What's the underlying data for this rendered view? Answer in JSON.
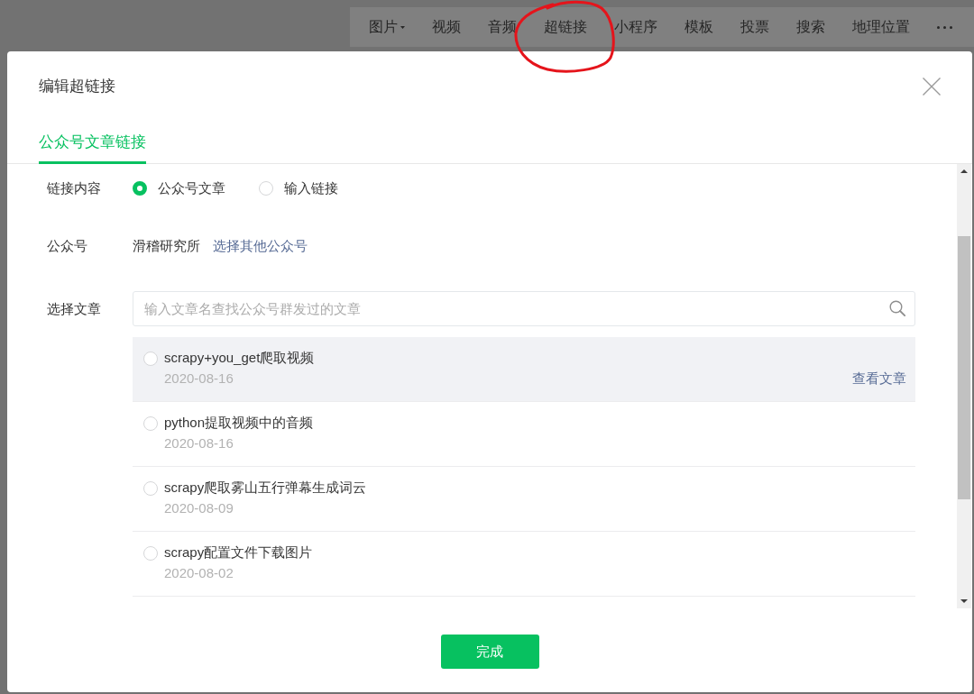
{
  "toolbar": {
    "items": [
      {
        "label": "图片",
        "dropdown": true,
        "circled": false
      },
      {
        "label": "视频",
        "dropdown": false,
        "circled": false
      },
      {
        "label": "音频",
        "dropdown": false,
        "circled": false
      },
      {
        "label": "超链接",
        "dropdown": false,
        "circled": true
      },
      {
        "label": "小程序",
        "dropdown": false,
        "circled": false
      },
      {
        "label": "模板",
        "dropdown": false,
        "circled": false
      },
      {
        "label": "投票",
        "dropdown": false,
        "circled": false
      },
      {
        "label": "搜索",
        "dropdown": false,
        "circled": false
      },
      {
        "label": "地理位置",
        "dropdown": false,
        "circled": false
      }
    ]
  },
  "dialog": {
    "title": "编辑超链接",
    "tabs": [
      {
        "label": "公众号文章链接",
        "selected": true
      }
    ],
    "link_content": {
      "label": "链接内容",
      "options": [
        {
          "label": "公众号文章",
          "selected": true
        },
        {
          "label": "输入链接",
          "selected": false
        }
      ]
    },
    "account": {
      "label": "公众号",
      "name": "滑稽研究所",
      "link": "选择其他公众号"
    },
    "article": {
      "label": "选择文章",
      "search": {
        "placeholder": "输入文章名查找公众号群发过的文章"
      },
      "items": [
        {
          "title": "scrapy+you_get爬取视频",
          "date": "2020-08-16",
          "selected": false,
          "hovered": true,
          "action": "查看文章"
        },
        {
          "title": "python提取视频中的音频",
          "date": "2020-08-16",
          "selected": false,
          "hovered": false
        },
        {
          "title": "scrapy爬取雾山五行弹幕生成词云",
          "date": "2020-08-09",
          "selected": false,
          "hovered": false
        },
        {
          "title": "scrapy配置文件下载图片",
          "date": "2020-08-02",
          "selected": false,
          "hovered": false
        }
      ]
    },
    "button": "完成"
  }
}
